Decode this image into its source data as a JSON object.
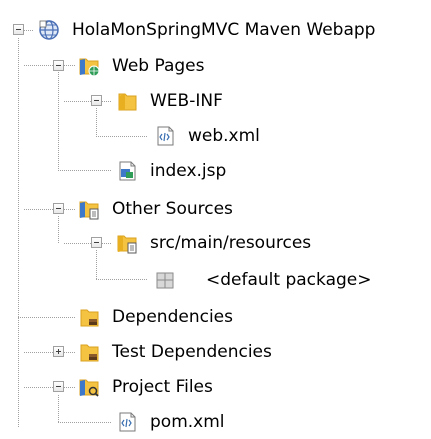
{
  "tree": {
    "project": {
      "label": "HolaMonSpringMVC Maven Webapp",
      "icon": "maven-project-globe-icon",
      "expanded": true
    },
    "nodes": [
      {
        "label": "Web Pages",
        "icon": "web-pages-folder-icon",
        "expanded": true
      },
      {
        "label": "WEB-INF",
        "icon": "folder-icon",
        "expanded": true
      },
      {
        "label": "web.xml",
        "icon": "xml-file-icon"
      },
      {
        "label": "index.jsp",
        "icon": "jsp-file-icon"
      },
      {
        "label": "Other Sources",
        "icon": "other-sources-folder-icon",
        "expanded": true
      },
      {
        "label": "src/main/resources",
        "icon": "resources-folder-icon",
        "expanded": true
      },
      {
        "label": "<default package>",
        "icon": "package-icon"
      },
      {
        "label": "Dependencies",
        "icon": "library-folder-icon"
      },
      {
        "label": "Test Dependencies",
        "icon": "library-folder-icon",
        "expanded": false
      },
      {
        "label": "Project Files",
        "icon": "project-files-folder-icon",
        "expanded": true
      },
      {
        "label": "pom.xml",
        "icon": "xml-file-icon"
      }
    ]
  },
  "colors": {
    "folder": "#f5c342",
    "folder_dark": "#d9a21f",
    "guide": "#a0a0a0",
    "globe": "#4a6fb5"
  }
}
